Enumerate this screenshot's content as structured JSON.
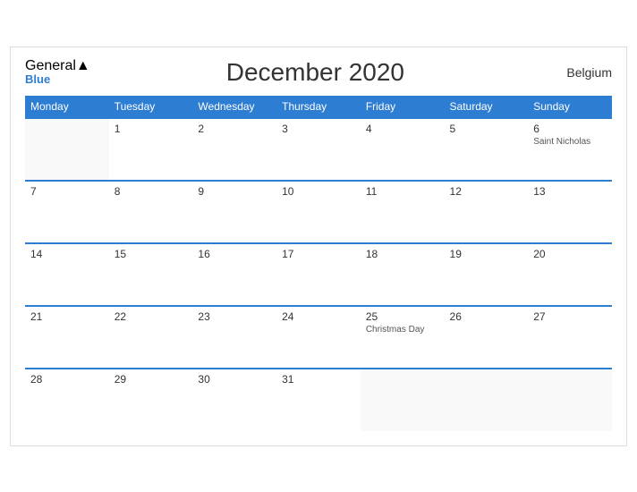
{
  "header": {
    "logo": {
      "general": "General",
      "blue": "Blue",
      "triangle_label": "logo-triangle"
    },
    "title": "December 2020",
    "country": "Belgium"
  },
  "weekdays": [
    "Monday",
    "Tuesday",
    "Wednesday",
    "Thursday",
    "Friday",
    "Saturday",
    "Sunday"
  ],
  "weeks": [
    [
      {
        "day": "",
        "event": ""
      },
      {
        "day": "1",
        "event": ""
      },
      {
        "day": "2",
        "event": ""
      },
      {
        "day": "3",
        "event": ""
      },
      {
        "day": "4",
        "event": ""
      },
      {
        "day": "5",
        "event": ""
      },
      {
        "day": "6",
        "event": "Saint Nicholas"
      }
    ],
    [
      {
        "day": "7",
        "event": ""
      },
      {
        "day": "8",
        "event": ""
      },
      {
        "day": "9",
        "event": ""
      },
      {
        "day": "10",
        "event": ""
      },
      {
        "day": "11",
        "event": ""
      },
      {
        "day": "12",
        "event": ""
      },
      {
        "day": "13",
        "event": ""
      }
    ],
    [
      {
        "day": "14",
        "event": ""
      },
      {
        "day": "15",
        "event": ""
      },
      {
        "day": "16",
        "event": ""
      },
      {
        "day": "17",
        "event": ""
      },
      {
        "day": "18",
        "event": ""
      },
      {
        "day": "19",
        "event": ""
      },
      {
        "day": "20",
        "event": ""
      }
    ],
    [
      {
        "day": "21",
        "event": ""
      },
      {
        "day": "22",
        "event": ""
      },
      {
        "day": "23",
        "event": ""
      },
      {
        "day": "24",
        "event": ""
      },
      {
        "day": "25",
        "event": "Christmas Day"
      },
      {
        "day": "26",
        "event": ""
      },
      {
        "day": "27",
        "event": ""
      }
    ],
    [
      {
        "day": "28",
        "event": ""
      },
      {
        "day": "29",
        "event": ""
      },
      {
        "day": "30",
        "event": ""
      },
      {
        "day": "31",
        "event": ""
      },
      {
        "day": "",
        "event": ""
      },
      {
        "day": "",
        "event": ""
      },
      {
        "day": "",
        "event": ""
      }
    ]
  ],
  "colors": {
    "header_bg": "#2d7dd2",
    "border": "#2d7dd2",
    "accent": "#2d7dd2"
  }
}
